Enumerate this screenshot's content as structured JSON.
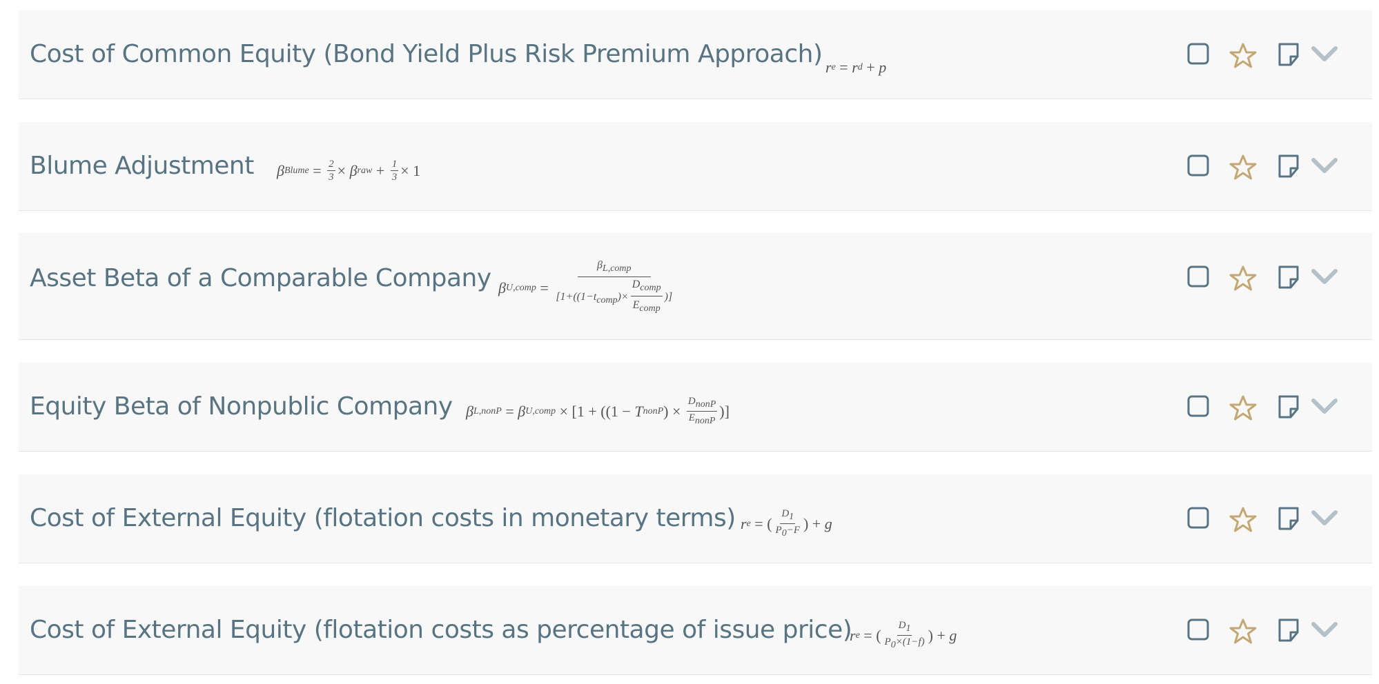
{
  "rows": [
    {
      "title": "Cost of Common Equity (Bond Yield Plus Risk Premium Approach)",
      "formula": "r_e = r_d + p"
    },
    {
      "title": "Blume Adjustment",
      "formula": "β_Blume = 2/3 × β_raw + 1/3 × 1"
    },
    {
      "title": "Asset Beta of a Comparable Company",
      "formula": "β_U,comp = β_L,comp / [1+((1−t_comp)×D_comp/E_comp)]"
    },
    {
      "title": "Equity Beta of Nonpublic Company",
      "formula": "β_L,nonP = β_U,comp × [1 + ((1 − T_nonP) × D_nonP/E_nonP)]"
    },
    {
      "title": "Cost of External Equity (flotation costs in monetary terms)",
      "formula": "r_e = (D_1/(P_0−F)) + g"
    },
    {
      "title": "Cost of External Equity (flotation costs as percentage of issue price)",
      "formula": "r_e = (D_1/(P_0×(1−f))) + g"
    }
  ],
  "icons": {
    "checkbox": "square-outline-icon",
    "favorite": "star-outline-icon",
    "note": "sticky-note-icon",
    "expand": "chevron-down-icon"
  },
  "colors": {
    "title": "#587482",
    "icon": "#587482",
    "star": "#c4a874",
    "chevron": "#b3c1c8",
    "card_bg": "#f8f8f8"
  }
}
